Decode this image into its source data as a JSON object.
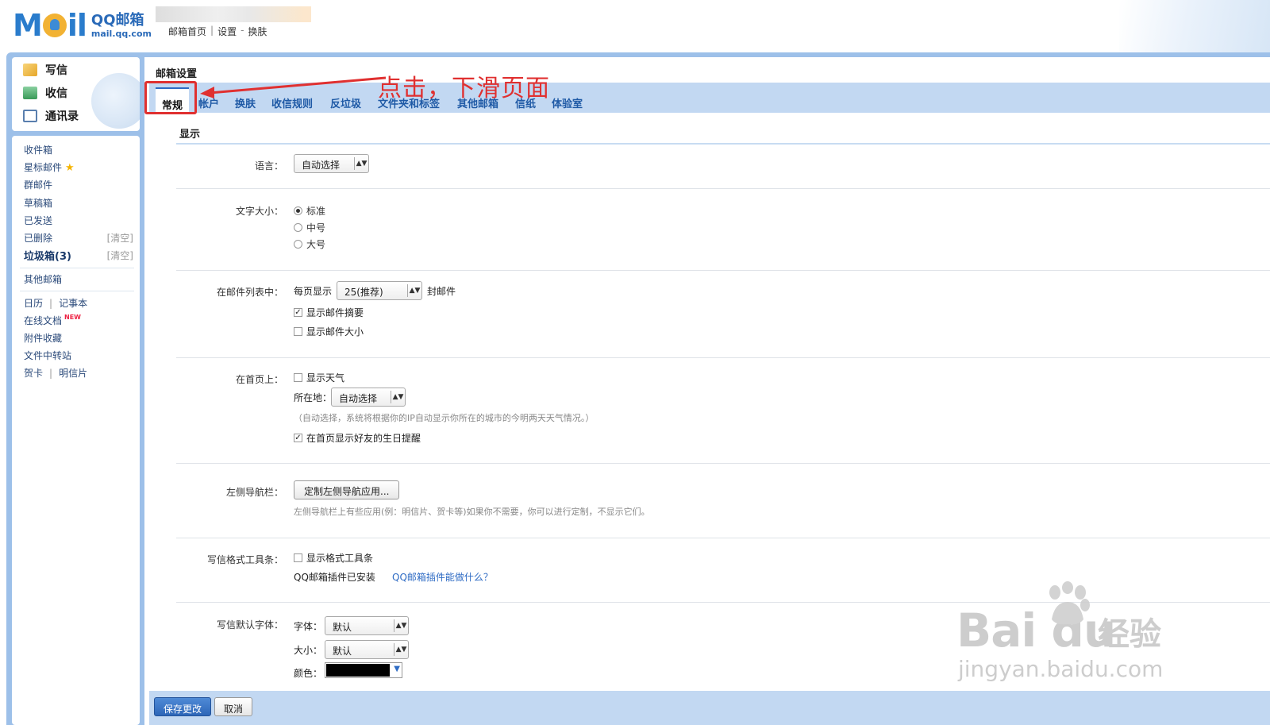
{
  "header": {
    "logo_brand": "MOil",
    "logo_name": "QQ邮箱",
    "logo_domain": "mail.qq.com",
    "links": [
      "邮箱首页",
      "设置",
      "换肤"
    ]
  },
  "quick_actions": [
    "写信",
    "收信",
    "通讯录"
  ],
  "folders": {
    "inbox": "收件箱",
    "starred": "星标邮件",
    "group": "群邮件",
    "drafts": "草稿箱",
    "sent": "已发送",
    "deleted": "已删除",
    "spam": "垃圾箱(3)",
    "clear": "[清空]",
    "other_mail": "其他邮箱",
    "calendar": "日历",
    "notes": "记事本",
    "docs": "在线文档",
    "docs_new": "NEW",
    "attachments": "附件收藏",
    "transfer": "文件中转站",
    "cards": "贺卡",
    "postcards": "明信片"
  },
  "settings": {
    "title": "邮箱设置",
    "tabs": [
      "常规",
      "帐户",
      "换肤",
      "收信规则",
      "反垃圾",
      "文件夹和标签",
      "其他邮箱",
      "信纸",
      "体验室"
    ],
    "annotation": "点击，下滑页面",
    "section": "显示",
    "language": {
      "label": "语言：",
      "value": "自动选择"
    },
    "font_size": {
      "label": "文字大小：",
      "options": [
        "标准",
        "中号",
        "大号"
      ],
      "selected": "标准"
    },
    "mail_list": {
      "label": "在邮件列表中：",
      "per_page_prefix": "每页显示",
      "per_page_value": "25(推荐)",
      "per_page_suffix": "封邮件",
      "show_summary": "显示邮件摘要",
      "show_size": "显示邮件大小"
    },
    "homepage": {
      "label": "在首页上：",
      "show_weather": "显示天气",
      "location_label": "所在地：",
      "location_value": "自动选择",
      "location_hint": "（自动选择，系统将根据你的IP自动显示你所在的城市的今明两天天气情况。）",
      "show_birthdays": "在首页显示好友的生日提醒"
    },
    "left_nav": {
      "label": "左侧导航栏：",
      "button": "定制左侧导航应用...",
      "hint": "左侧导航栏上有些应用(例：明信片、贺卡等)如果你不需要，你可以进行定制，不显示它们。"
    },
    "format_toolbar": {
      "label": "写信格式工具条：",
      "checkbox": "显示格式工具条",
      "plugin_status": "QQ邮箱插件已安装",
      "plugin_link": "QQ邮箱插件能做什么？"
    },
    "default_font": {
      "label": "写信默认字体：",
      "font_label": "字体：",
      "font_value": "默认",
      "size_label": "大小：",
      "size_value": "默认",
      "color_label": "颜色：",
      "color_value": "#000000"
    },
    "save_button": "保存更改",
    "cancel_button": "取消"
  },
  "watermark": {
    "brand": "Bai  du",
    "cn": "经验",
    "url": "jingyan.baidu.com"
  },
  "colors": {
    "frame": "#9dc0e9",
    "tabbar": "#c2d8f2",
    "accent": "#2e6bc4",
    "annotation": "#e03030"
  }
}
